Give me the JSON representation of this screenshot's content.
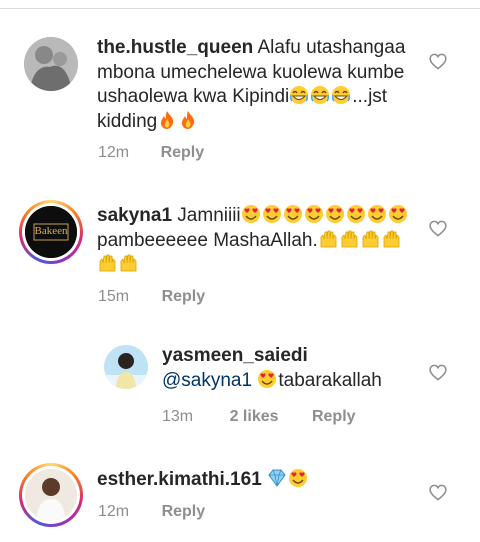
{
  "comments": [
    {
      "username": "the.hustle_queen",
      "segments": [
        {
          "t": "Alafu utashangaa mbona umechelewa kuolewa kumbe ushaolewa kwa Kipindi"
        },
        {
          "e": "grin"
        },
        {
          "e": "grin"
        },
        {
          "e": "grin"
        },
        {
          "t": "...jst kidding"
        },
        {
          "e": "fire"
        },
        {
          "e": "fire"
        }
      ],
      "time": "12m",
      "reply_label": "Reply",
      "avatar_icon": "profile-photo"
    },
    {
      "username": "sakyna1",
      "avatar_text": "Bakeen",
      "segments": [
        {
          "t": "Jamniiii"
        },
        {
          "e": "hearteyes"
        },
        {
          "e": "hearteyes"
        },
        {
          "e": "hearteyes"
        },
        {
          "e": "hearteyes"
        },
        {
          "e": "hearteyes"
        },
        {
          "e": "hearteyes"
        },
        {
          "e": "hearteyes"
        },
        {
          "e": "hearteyes"
        },
        {
          "t": "pambeeeeee MashaAllah."
        },
        {
          "e": "hands"
        },
        {
          "e": "hands"
        },
        {
          "e": "hands"
        },
        {
          "e": "hands"
        },
        {
          "e": "hands"
        },
        {
          "e": "hands"
        }
      ],
      "time": "15m",
      "reply_label": "Reply",
      "avatar_icon": "store-logo"
    },
    {
      "username": "yasmeen_saiedi",
      "segments": [
        {
          "m": "@sakyna1"
        },
        {
          "t": " "
        },
        {
          "e": "hearteyes"
        },
        {
          "t": "tabarakallah"
        }
      ],
      "time": "13m",
      "likes": "2 likes",
      "reply_label": "Reply",
      "avatar_icon": "profile-photo"
    },
    {
      "username": "esther.kimathi.161",
      "segments": [
        {
          "e": "gem"
        },
        {
          "e": "hearteyes"
        }
      ],
      "time": "12m",
      "reply_label": "Reply",
      "avatar_icon": "profile-photo"
    }
  ],
  "colors": {
    "text": "#262626",
    "meta": "#8e8e8e",
    "mention": "#003569"
  }
}
